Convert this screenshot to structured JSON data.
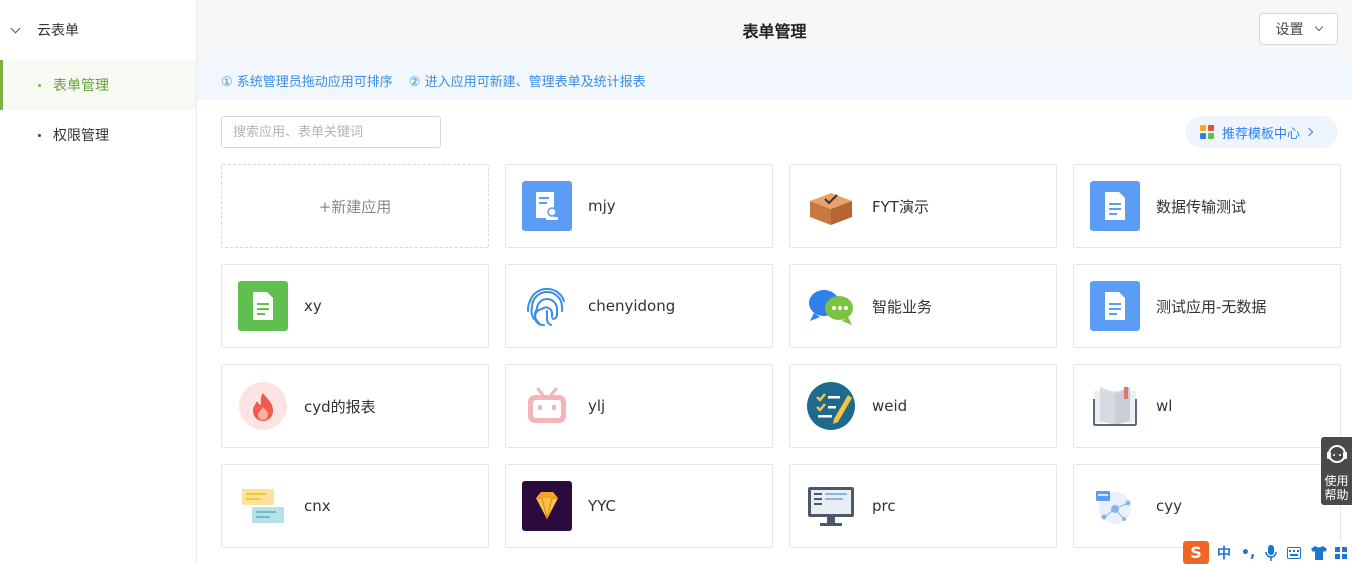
{
  "sidebar": {
    "group_label": "云表单",
    "items": [
      {
        "label": "表单管理",
        "active": true
      },
      {
        "label": "权限管理",
        "active": false
      }
    ]
  },
  "header": {
    "title": "表单管理",
    "settings_label": "设置"
  },
  "tips": {
    "tip1": "① 系统管理员拖动应用可排序",
    "tip2": "② 进入应用可新建、管理表单及统计报表"
  },
  "toolbar": {
    "search_placeholder": "搜索应用、表单关键词",
    "template_center_label": "推荐模板中心"
  },
  "new_app_label": "+新建应用",
  "apps": [
    {
      "name": "mjy",
      "icon": "form-doc-icon",
      "color": "#5b9cf4"
    },
    {
      "name": "FYT演示",
      "icon": "package-box-icon",
      "color": "#d9894f"
    },
    {
      "name": "数据传输测试",
      "icon": "document-icon",
      "color": "#5b9cf4"
    },
    {
      "name": "xy",
      "icon": "document-icon",
      "color": "#5fbf4f"
    },
    {
      "name": "chenyidong",
      "icon": "fingerprint-icon",
      "color": "#3a8ee6"
    },
    {
      "name": "智能业务",
      "icon": "chat-bubbles-icon",
      "color": "#2f80ed"
    },
    {
      "name": "测试应用-无数据",
      "icon": "document-icon",
      "color": "#5b9cf4"
    },
    {
      "name": "cyd的报表",
      "icon": "flame-icon",
      "color": "#f05a4f"
    },
    {
      "name": "ylj",
      "icon": "tv-robot-icon",
      "color": "#f3b6b6"
    },
    {
      "name": "weid",
      "icon": "checklist-pencil-icon",
      "color": "#1e6a8c"
    },
    {
      "name": "wl",
      "icon": "open-book-icon",
      "color": "#8d9aa8"
    },
    {
      "name": "cnx",
      "icon": "sticky-notes-icon",
      "color": "#f6c343"
    },
    {
      "name": "YYC",
      "icon": "diamond-icon",
      "color": "#f6a623"
    },
    {
      "name": "prc",
      "icon": "monitor-icon",
      "color": "#4a5a6a"
    },
    {
      "name": "cyy",
      "icon": "network-nodes-icon",
      "color": "#8ab4e8"
    }
  ],
  "help": {
    "line1": "使用",
    "line2": "帮助"
  },
  "ime": {
    "lang": "中",
    "punct": "•,"
  }
}
